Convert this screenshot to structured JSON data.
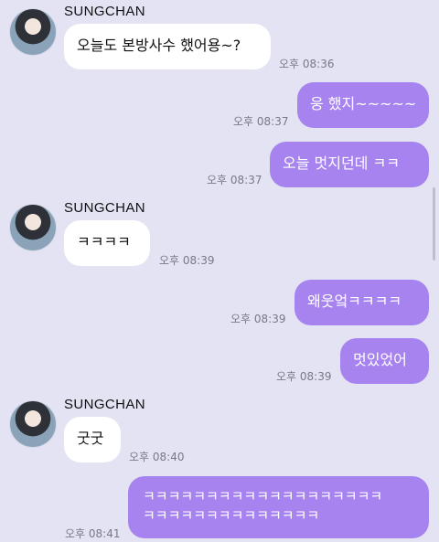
{
  "chat": {
    "sender_name": "SUNGCHAN",
    "messages": [
      {
        "from": "in",
        "text": "오늘도 본방사수 했어용~?",
        "time": "오후 08:36"
      },
      {
        "from": "out",
        "text": "웅 했지~~~~~",
        "time": "오후 08:37"
      },
      {
        "from": "out",
        "text": "오늘 멋지던데 ㅋㅋ",
        "time": "오후 08:37"
      },
      {
        "from": "in",
        "text": "ㅋㅋㅋㅋ",
        "time": "오후 08:39"
      },
      {
        "from": "out",
        "text": "왜웃엌ㅋㅋㅋㅋ",
        "time": "오후 08:39"
      },
      {
        "from": "out",
        "text": "멋있었어",
        "time": "오후 08:39"
      },
      {
        "from": "in",
        "text": "굿굿",
        "time": "오후 08:40"
      },
      {
        "from": "out",
        "lines": [
          "ㅋㅋㅋㅋㅋㅋㅋㅋㅋㅋㅋㅋㅋㅋㅋㅋㅋㅋㅋ",
          "ㅋㅋㅋㅋㅋㅋㅋㅋㅋㅋㅋㅋㅋㅋ"
        ],
        "time": "오후 08:41"
      }
    ]
  }
}
